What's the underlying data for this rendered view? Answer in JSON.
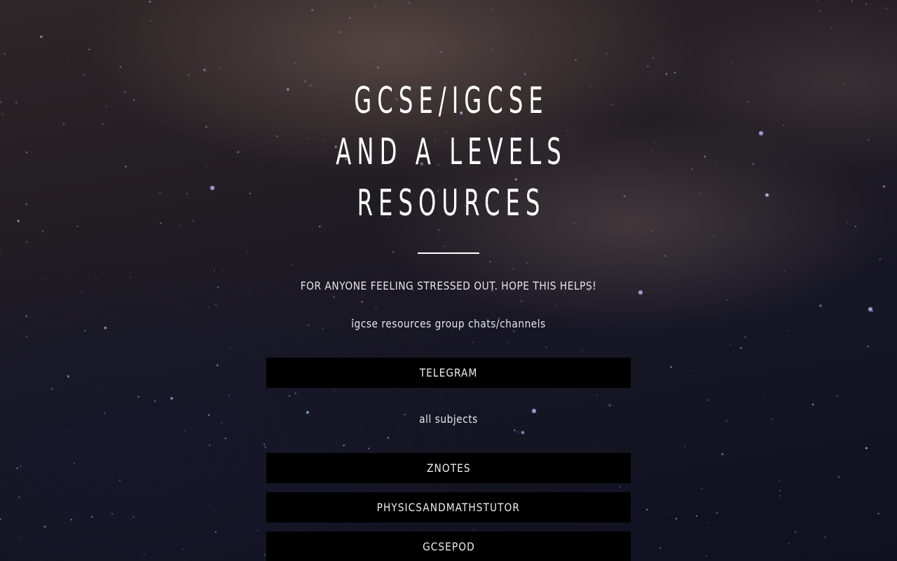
{
  "hero": {
    "title_lines": [
      "GCSE/IGCSE",
      "AND A LEVELS",
      "RESOURCES"
    ],
    "tagline": "FOR ANYONE FEELING STRESSED OUT. HOPE THIS HELPS!"
  },
  "sections": [
    {
      "caption": "igcse resources group chats/channels",
      "links": [
        {
          "label": "TELEGRAM"
        }
      ]
    },
    {
      "caption": "all subjects",
      "links": [
        {
          "label": "ZNOTES"
        },
        {
          "label": "PHYSICSANDMATHSTUTOR"
        },
        {
          "label": "GCSEPOD"
        }
      ]
    }
  ],
  "colors": {
    "text": "#ffffff",
    "button_background": "#000000",
    "background_dark": "#16141d"
  }
}
